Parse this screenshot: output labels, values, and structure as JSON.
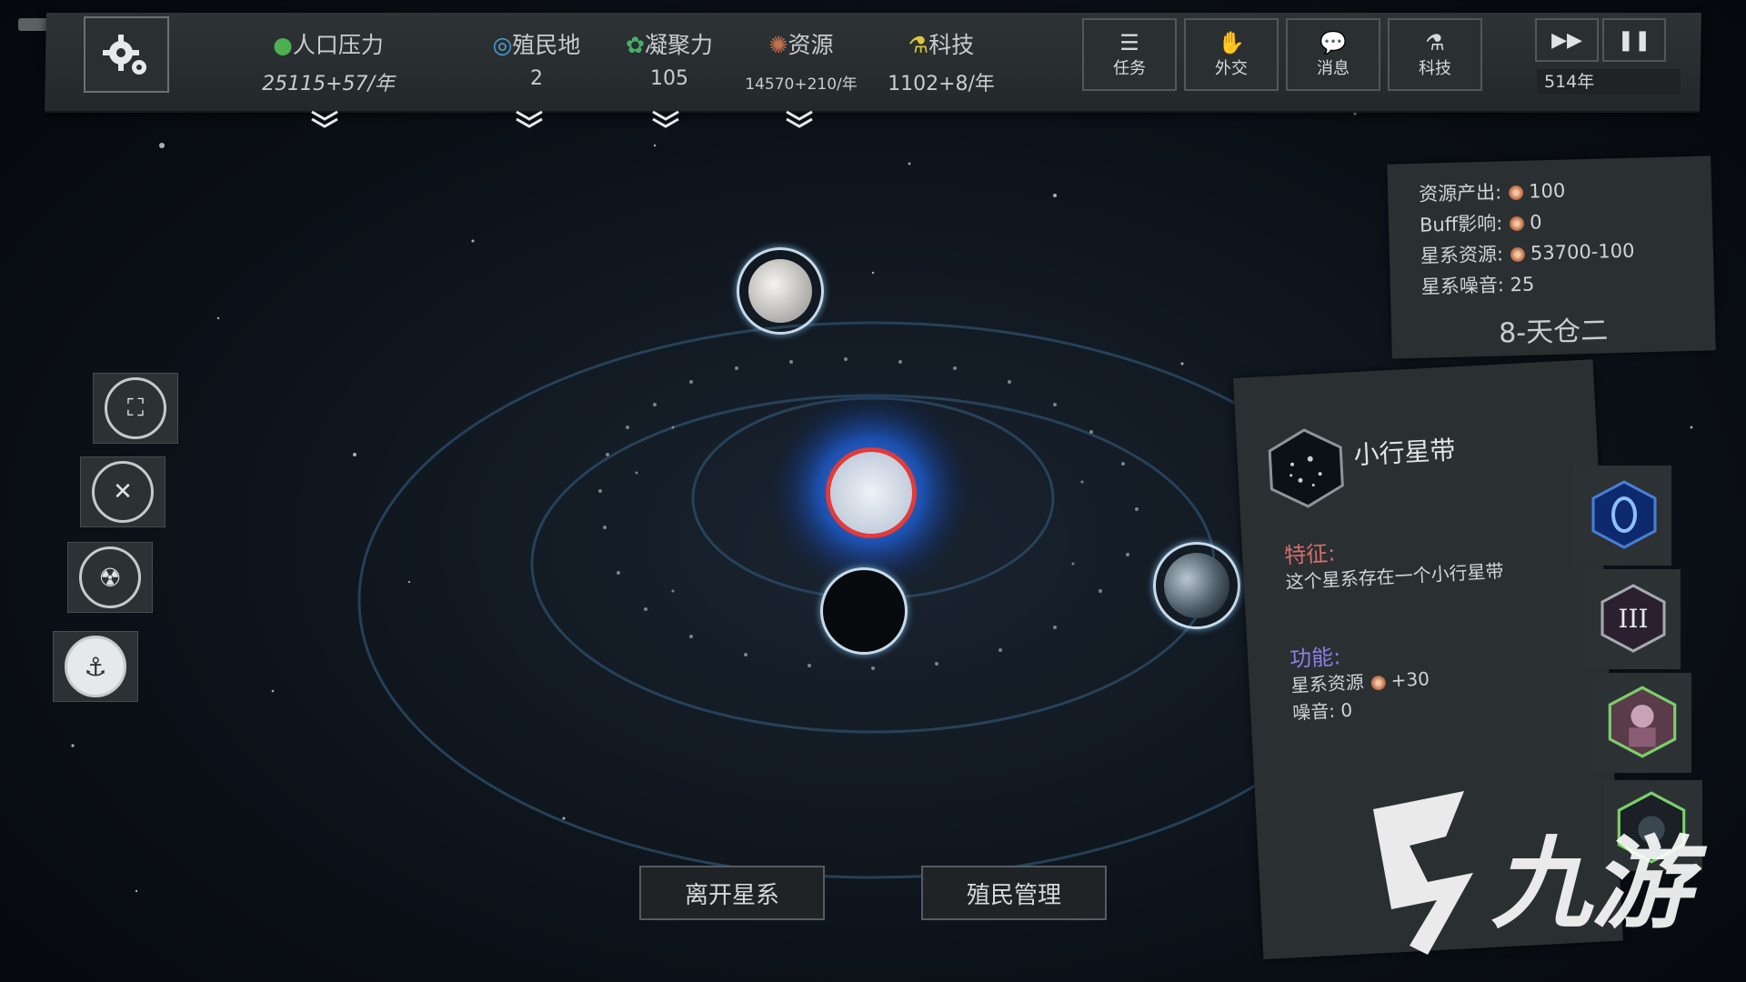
{
  "topbar": {
    "stats": [
      {
        "label": "人口压力",
        "value": "25115+57/年",
        "icon": "population-icon",
        "color": "#4caf50"
      },
      {
        "label": "殖民地",
        "value": "2",
        "icon": "colony-icon",
        "color": "#4aa3d8"
      },
      {
        "label": "凝聚力",
        "value": "105",
        "icon": "cohesion-icon",
        "color": "#47b06a"
      },
      {
        "label": "资源",
        "value": "14570+210/年",
        "icon": "resource-icon",
        "color": "#c2714c"
      },
      {
        "label": "科技",
        "value": "1102+8/年",
        "icon": "tech-icon",
        "color": "#d9c840"
      }
    ],
    "buttons": [
      {
        "label": "任务",
        "icon": "task-icon"
      },
      {
        "label": "外交",
        "icon": "handshake-icon"
      },
      {
        "label": "消息",
        "icon": "chat-icon"
      },
      {
        "label": "科技",
        "icon": "flask-icon"
      }
    ],
    "speed": {
      "fast_forward": "▶▶",
      "pause": "❚❚"
    },
    "year": "514年"
  },
  "system_info": {
    "rows": [
      {
        "label": "资源产出:",
        "value": "100"
      },
      {
        "label": "Buff影响:",
        "value": "0"
      },
      {
        "label": "星系资源:",
        "value": "53700-100"
      },
      {
        "label": "星系噪音:",
        "value": "25"
      }
    ],
    "name": "8-天仓二"
  },
  "left_tools": [
    "focus-icon",
    "tools-icon",
    "radiation-icon",
    "anchor-icon"
  ],
  "detail": {
    "title": "小行星带",
    "feature_header": "特征:",
    "feature_text": "这个星系存在一个小行星带",
    "function_header": "功能:",
    "function_line1_label": "星系资源",
    "function_line1_value": "+30",
    "function_line2": "噪音: 0"
  },
  "bottom": {
    "leave": "离开星系",
    "colony_mgmt": "殖民管理"
  },
  "watermark": "九游"
}
